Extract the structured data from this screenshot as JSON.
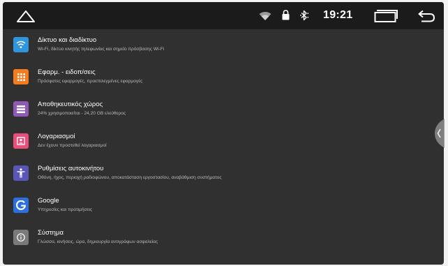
{
  "status_bar": {
    "time": "19:21",
    "icons": [
      "home-icon",
      "wifi-icon",
      "lock-icon",
      "bluetooth-icon",
      "recents-icon",
      "back-icon"
    ]
  },
  "settings": [
    {
      "title": "Δίκτυο και διαδίκτυο",
      "subtitle": "Wi-Fi, δίκτυο κινητής τηλεφωνίας και σημείο πρόσβασης Wi-Fi",
      "icon": "wifi-icon",
      "color": "#2f95dc"
    },
    {
      "title": "Εφαρμ. - ειδοπ/σεις",
      "subtitle": "Πρόσφατες εφαρμογές, προεπιλεγμένες εφαρμογές",
      "icon": "apps-icon",
      "color": "#f57c1f"
    },
    {
      "title": "Αποθηκευτικός χώρος",
      "subtitle": "24% χρησιμοποιείται - 24,20 GB ελεύθερος",
      "icon": "storage-icon",
      "color": "#8e5ab6"
    },
    {
      "title": "Λογαριασμοί",
      "subtitle": "Δεν έχουν προστεθεί λογαριασμοί",
      "icon": "account-icon",
      "color": "#e84f7a"
    },
    {
      "title": "Ρυθμίσεις αυτοκινήτου",
      "subtitle": "Οθόνη, ήχος, περιοχή ραδιοφώνου, αποκατάσταση εργοστασίου, αναβάθμιση συστήματος",
      "icon": "accessibility-icon",
      "color": "#5a56b8"
    },
    {
      "title": "Google",
      "subtitle": "Υπηρεσίες και προτιμήσεις",
      "icon": "google-icon",
      "color": "#2b6fe0"
    },
    {
      "title": "Σύστημα",
      "subtitle": "Γλώσσα, κινήσεις, ώρα, δημιουργία αντιγράφων ασφαλείας",
      "icon": "info-icon",
      "color": "#7a7a7a"
    }
  ]
}
